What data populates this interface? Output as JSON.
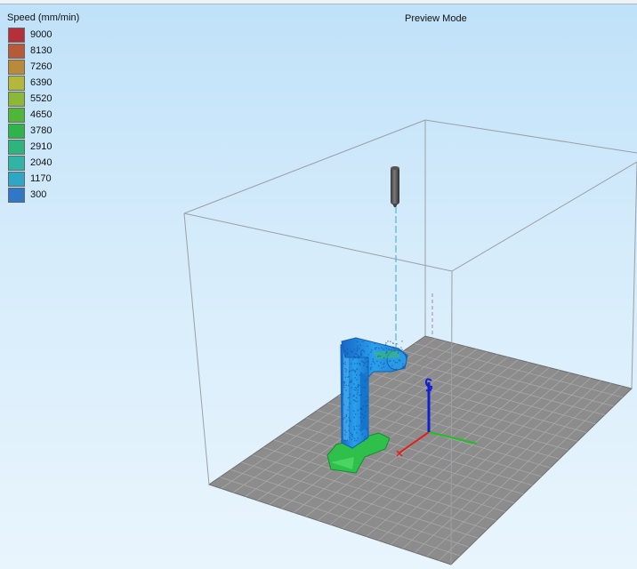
{
  "legend": {
    "title": "Speed (mm/min)",
    "items": [
      {
        "label": "9000",
        "color": "#b5303a"
      },
      {
        "label": "8130",
        "color": "#b65a3a"
      },
      {
        "label": "7260",
        "color": "#b88a3a"
      },
      {
        "label": "6390",
        "color": "#b4b83a"
      },
      {
        "label": "5520",
        "color": "#8cb83a"
      },
      {
        "label": "4650",
        "color": "#4fb63a"
      },
      {
        "label": "3780",
        "color": "#2fb44c"
      },
      {
        "label": "2910",
        "color": "#2fb47c"
      },
      {
        "label": "2040",
        "color": "#2fb4a6"
      },
      {
        "label": "1170",
        "color": "#2fa6c6"
      },
      {
        "label": "300",
        "color": "#2f78c8"
      }
    ]
  },
  "viewport": {
    "mode_label": "Preview Mode",
    "bed_color": "#8c8c8c",
    "model_color": "#1e8ee0",
    "base_color": "#2ec04a",
    "axis_colors": {
      "x": "#e02020",
      "y": "#20c020",
      "z": "#1020d0"
    }
  }
}
